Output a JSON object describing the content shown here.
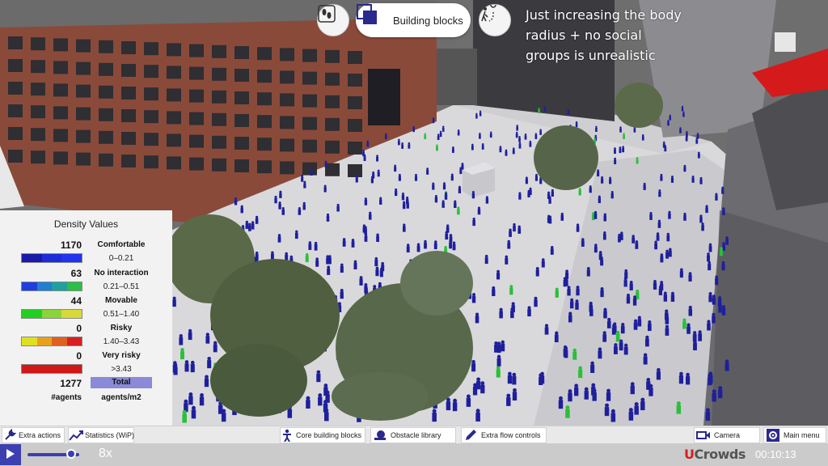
{
  "overlay": {
    "building_blocks_label": "Building blocks",
    "caption": "Just increasing the body radius + no social groups is unrealistic"
  },
  "density_panel": {
    "title": "Density Values",
    "rows": [
      {
        "count": "1170",
        "label": "Comfortable",
        "range": "0–0.21",
        "colors": [
          "#1a1aa8",
          "#1d2bd8",
          "#2233f0"
        ]
      },
      {
        "count": "63",
        "label": "No interaction",
        "range": "0.21–0.51",
        "colors": [
          "#1e3ee0",
          "#1f7fd0",
          "#1fa0a0",
          "#2bbf4a"
        ]
      },
      {
        "count": "44",
        "label": "Movable",
        "range": "0.51–1.40",
        "colors": [
          "#22d022",
          "#8ad43a",
          "#d8d83a"
        ]
      },
      {
        "count": "0",
        "label": "Risky",
        "range": "1.40–3.43",
        "colors": [
          "#e0e020",
          "#e8a020",
          "#e06020",
          "#d82020"
        ]
      },
      {
        "count": "0",
        "label": "Very risky",
        "range": ">3.43",
        "colors": [
          "#d01818",
          "#d01818"
        ]
      }
    ],
    "total_count": "1277",
    "total_label": "Total",
    "agents_label": "#agents",
    "units_label": "agents/m2"
  },
  "toolbar": {
    "extra_actions": "Extra actions",
    "statistics": "Statistics (WiP)",
    "core_building_blocks": "Core building blocks",
    "obstacle_library": "Obstacle library",
    "extra_flow_controls": "Extra flow controls",
    "camera": "Camera",
    "main_menu": "Main menu"
  },
  "playback": {
    "speed": "8x",
    "speed_fraction": 0.85,
    "brand_prefix": "U",
    "brand_rest": "Crowds",
    "time": "00:10:13"
  },
  "colors": {
    "accent": "#3b3fb0",
    "agent_blue": "#1f1f9c",
    "agent_green": "#2bbf3a"
  },
  "icons": {
    "footprints": "footprints-icon",
    "building_blocks": "building-blocks-icon",
    "route": "route-icon",
    "wrench": "wrench-icon",
    "chart": "chart-icon",
    "person": "person-icon",
    "obstacle": "obstacle-icon",
    "pencil": "pencil-icon",
    "camera": "camera-icon",
    "gear": "gear-icon",
    "play": "play-icon"
  }
}
